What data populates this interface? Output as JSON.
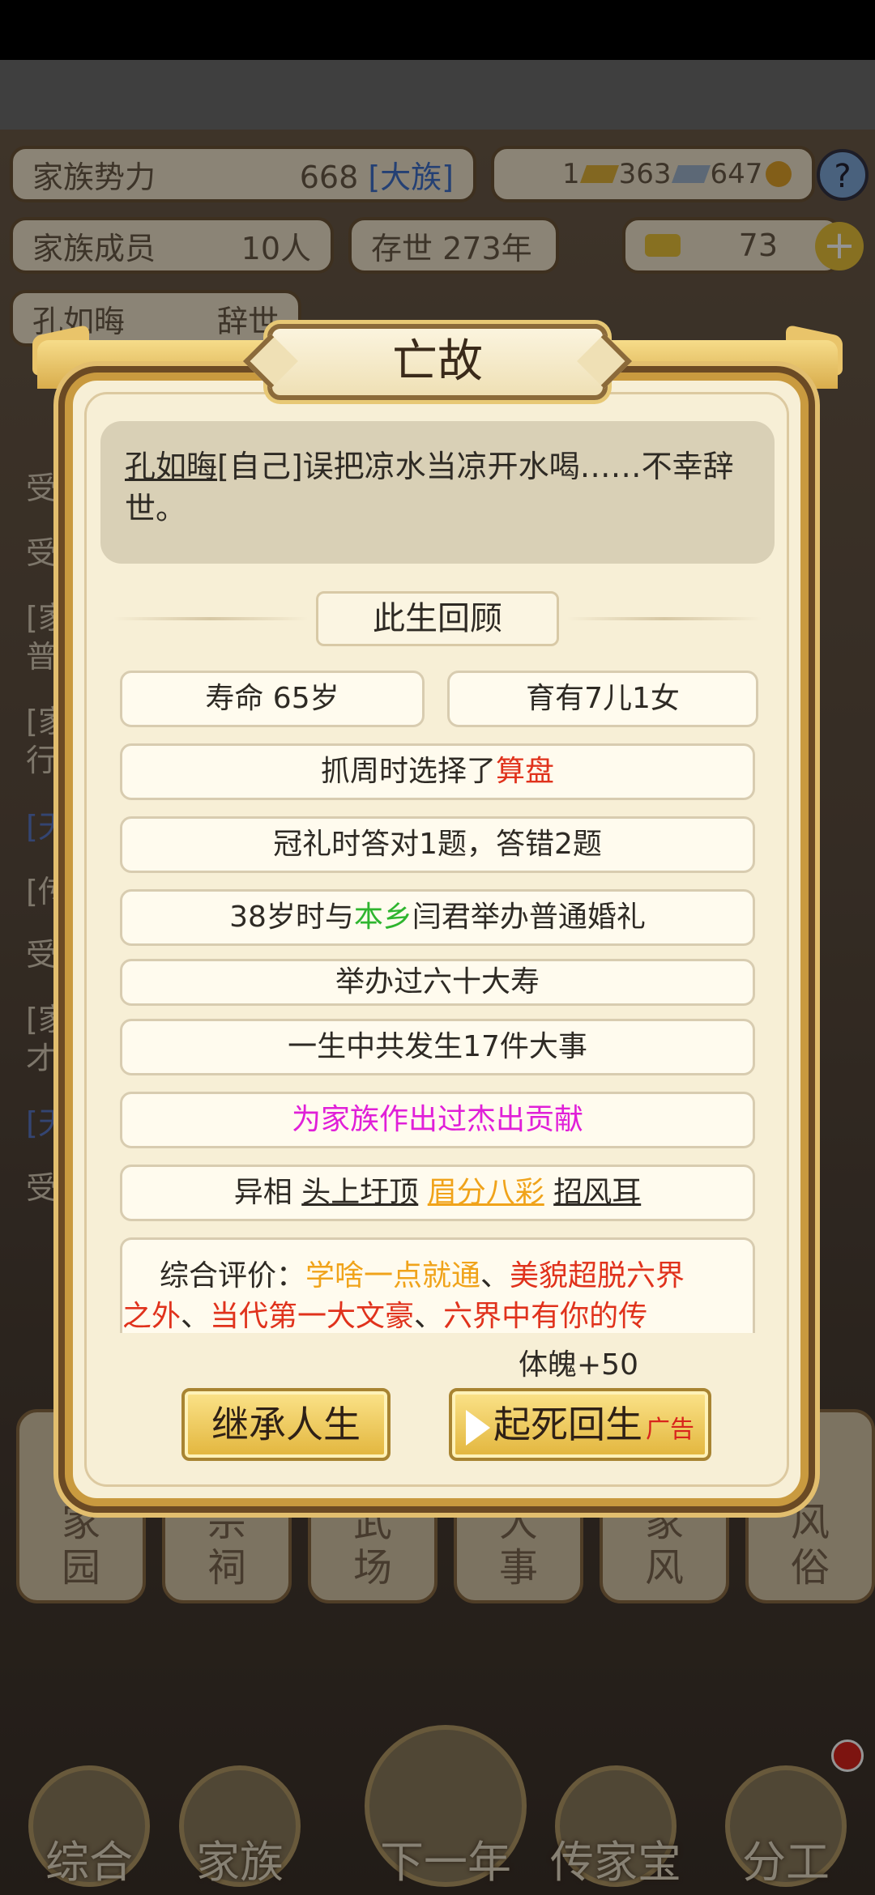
{
  "hud": {
    "clan_power_label": "家族势力",
    "clan_power_value": "668",
    "clan_rank": "[大族]",
    "res1": "1",
    "res2": "363",
    "res3": "647",
    "help_icon": "question-icon",
    "members_label": "家族成员",
    "members_value": "10人",
    "alive_label": "存世",
    "alive_value": "273年",
    "gold_value": "73",
    "self_name": "孔如晦",
    "self_status": "辞世"
  },
  "log_fragments": [
    "受",
    "受",
    "[家",
    "普",
    "[家",
    "行",
    "[天",
    "[传",
    "受",
    "[家",
    "才",
    "[天",
    "受"
  ],
  "side_tiles": [
    {
      "lines": "家\n园"
    },
    {
      "lines": "宗\n祠"
    },
    {
      "lines": "武\n场"
    },
    {
      "lines": "大\n事"
    },
    {
      "lines": "家\n风"
    },
    {
      "lines": "风\n俗"
    }
  ],
  "bottom_nav": [
    "综合",
    "家族",
    "下一年",
    "传家宝",
    "分工"
  ],
  "dialog": {
    "title": "亡故",
    "cause_name": "孔如晦",
    "cause_text": "[自己]误把凉水当凉开水喝……不幸辞世。",
    "review_title": "此生回顾",
    "lifespan": "寿命 65岁",
    "children": "育有7儿1女",
    "zhuazhou_prefix": "抓周时选择了",
    "zhuazhou_item": "算盘",
    "capping": "冠礼时答对1题，答错2题",
    "wedding_prefix": "38岁时与",
    "wedding_place": "本乡",
    "wedding_suffix": "闫君举办普通婚礼",
    "birthday": "举办过六十大寿",
    "events": "一生中共发生17件大事",
    "contribution": "为家族作出过杰出贡献",
    "traits_label": "异相",
    "trait1": "头上圩顶",
    "trait2": "眉分八彩",
    "trait3": "招风耳",
    "eval_label": "综合评价：",
    "eval_tag1": "学啥一点就通",
    "sep": "、",
    "eval_tag2": "美貌超脱六界",
    "eval_tag2b": "之外",
    "eval_tag3": "当代第一大文豪",
    "eval_tag4": "六界中有你的传",
    "reward": "体魄+50",
    "btn_inherit": "继承人生",
    "btn_revive": "起死回生",
    "btn_revive_ad": "广告"
  },
  "colors": {
    "highlight_red": "#e0321c",
    "highlight_green": "#2fb52f",
    "highlight_magenta": "#e01fd8",
    "highlight_orange": "#f0a31a"
  }
}
